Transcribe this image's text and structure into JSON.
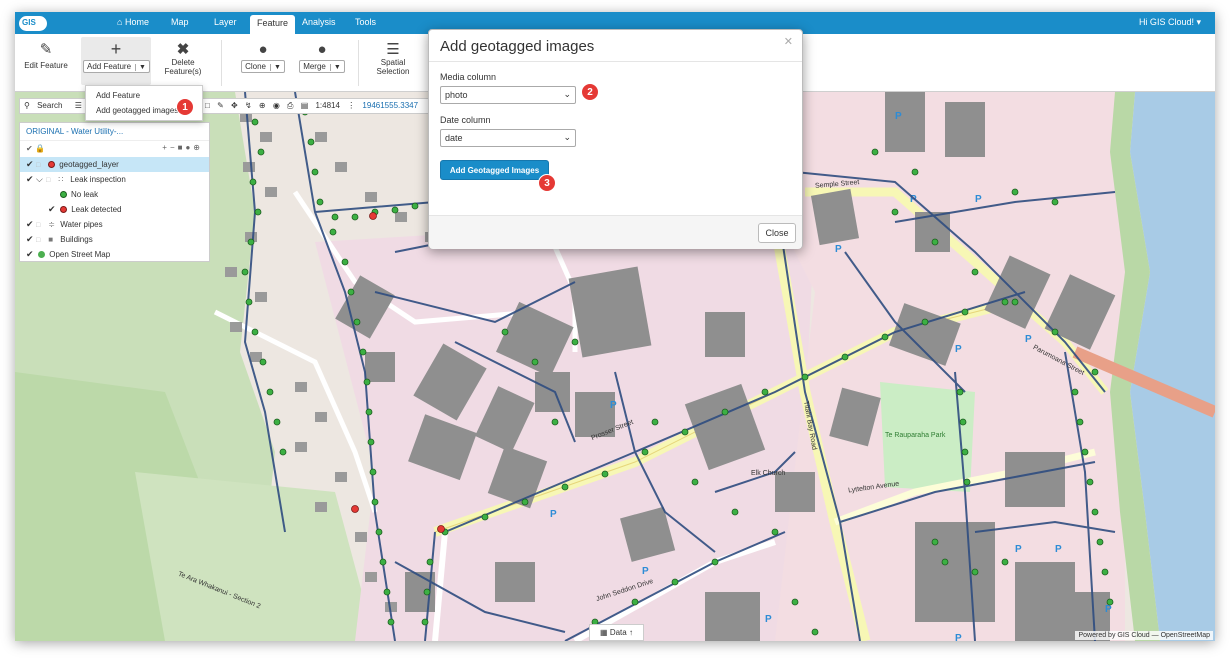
{
  "nav": {
    "logo_text": "GIS",
    "home": "Home",
    "map": "Map",
    "layer": "Layer",
    "feature": "Feature",
    "analysis": "Analysis",
    "tools": "Tools",
    "user": "Hi GIS Cloud!"
  },
  "ribbon": {
    "edit_feature": "Edit Feature",
    "add_feature": "Add Feature",
    "delete_feature_1": "Delete",
    "delete_feature_2": "Feature(s)",
    "clone": "Clone",
    "merge": "Merge",
    "spatial_1": "Spatial",
    "spatial_2": "Selection"
  },
  "add_menu": {
    "items": [
      "Add Feature",
      "Add geotagged images"
    ]
  },
  "markers": [
    "1",
    "2",
    "3"
  ],
  "map_toolbar": {
    "search": "Search",
    "scale": "1:4814",
    "coords": "19461555.3347"
  },
  "layers": {
    "project": "ORIGINAL - Water Utility-...",
    "items": [
      {
        "label": "geotagged_layer",
        "color": "#e53935"
      },
      {
        "label": "Leak inspection",
        "color": ""
      },
      {
        "label": "No leak",
        "color": "#2ea82e"
      },
      {
        "label": "Leak detected",
        "color": "#e53935"
      },
      {
        "label": "Water pipes",
        "color": ""
      },
      {
        "label": "Buildings",
        "color": ""
      },
      {
        "label": "Open Street Map",
        "color": "#4caf50"
      }
    ]
  },
  "dialog": {
    "title": "Add geotagged images",
    "media_label": "Media column",
    "media_value": "photo",
    "date_label": "Date column",
    "date_value": "date",
    "submit": "Add Geotagged Images",
    "close": "Close"
  },
  "map_labels": {
    "semple_street": "Semple Street",
    "prosser_street": "Prosser Street",
    "john_seddon": "John Seddon Drive",
    "te_rauparaha": "Te Rauparaha Park",
    "parumoana": "Parumoana Street",
    "titahi_bay": "Titahi Bay Road",
    "elk": "Elk Church",
    "lyttelton": "Lyttelton Avenue",
    "te_ara": "Te Ara Whakanui - Section 2"
  },
  "data_tab": "Data",
  "attribution": "Powered by GIS Cloud — OpenStreetMap"
}
